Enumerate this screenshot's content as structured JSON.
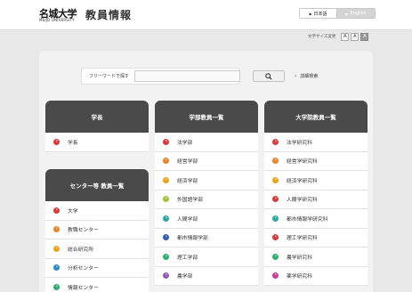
{
  "header": {
    "logo_main": "名城大学",
    "logo_sub": "MEIJO UNIVERSITY",
    "title": "教員情報",
    "lang_jp": "日本語",
    "lang_en": "English"
  },
  "fontsize": {
    "label": "文字サイズ変更",
    "buttons": [
      "A",
      "A",
      "A"
    ]
  },
  "search": {
    "label": "フリーワードで探す",
    "input_value": "",
    "advanced": "詳細検索"
  },
  "columns": {
    "president": {
      "title": "学長",
      "items": [
        {
          "label": "学長",
          "color": "#d83a3a"
        }
      ]
    },
    "centers": {
      "title": "センター等 教員一覧",
      "items": [
        {
          "label": "大学",
          "color": "#d83a3a"
        },
        {
          "label": "教職センター",
          "color": "#e8842a"
        },
        {
          "label": "総合研究所",
          "color": "#e8a51a"
        },
        {
          "label": "分析センター",
          "color": "#2d8ac9"
        },
        {
          "label": "情報センター",
          "color": "#2daf6d"
        }
      ]
    },
    "faculty": {
      "title": "学部教員一覧",
      "items": [
        {
          "label": "法学部",
          "color": "#d83a3a"
        },
        {
          "label": "経営学部",
          "color": "#e8842a"
        },
        {
          "label": "経済学部",
          "color": "#e8a51a"
        },
        {
          "label": "外国語学部",
          "color": "#9ec43a"
        },
        {
          "label": "人間学部",
          "color": "#2aa9a0"
        },
        {
          "label": "都市情報学部",
          "color": "#2d5fae"
        },
        {
          "label": "理工学部",
          "color": "#2daf6d"
        },
        {
          "label": "農学部",
          "color": "#8c5bb8"
        }
      ]
    },
    "graduate": {
      "title": "大学院教員一覧",
      "items": [
        {
          "label": "法学研究科",
          "color": "#d83a3a"
        },
        {
          "label": "経営学研究科",
          "color": "#e8842a"
        },
        {
          "label": "経済学研究科",
          "color": "#e8a51a"
        },
        {
          "label": "人間学研究科",
          "color": "#d83a3a"
        },
        {
          "label": "都市情報学研究科",
          "color": "#2aa9a0"
        },
        {
          "label": "理工学研究科",
          "color": "#d83a3a"
        },
        {
          "label": "農学研究科",
          "color": "#2daf6d"
        },
        {
          "label": "薬学研究科",
          "color": "#c93a9a"
        }
      ]
    }
  }
}
